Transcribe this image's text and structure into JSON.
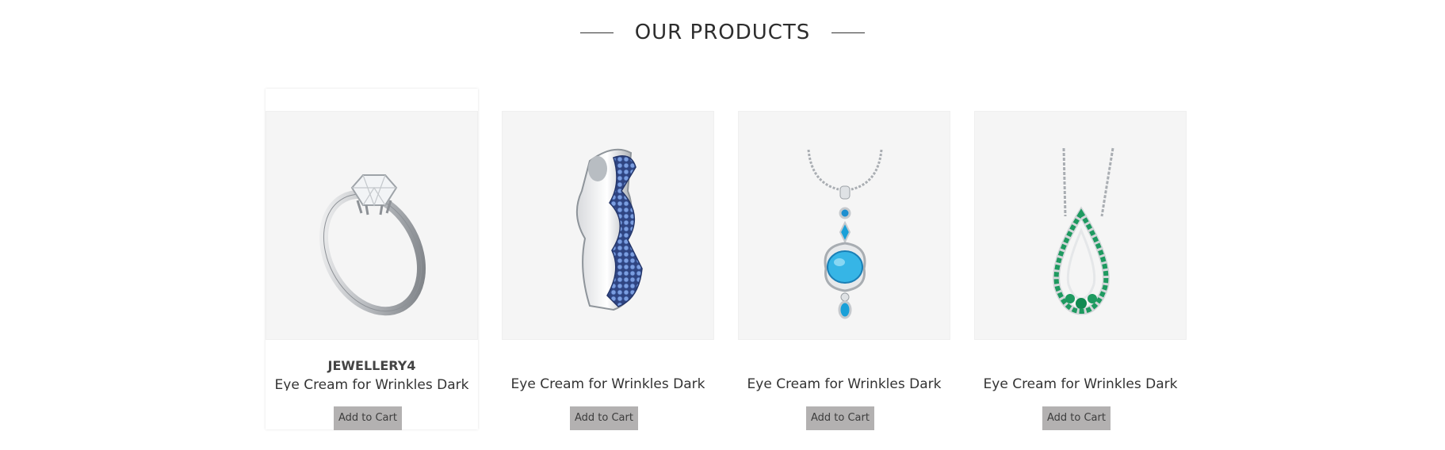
{
  "section": {
    "title": "OUR PRODUCTS"
  },
  "products": [
    {
      "brand": "JEWELLERY4",
      "name": "Eye Cream for Wrinkles Dark",
      "cart_label": "Add to Cart",
      "image": "diamond-ring-icon"
    },
    {
      "name": "Eye Cream for Wrinkles Dark",
      "cart_label": "Add to Cart",
      "image": "sapphire-band-ring-icon"
    },
    {
      "name": "Eye Cream for Wrinkles Dark",
      "cart_label": "Add to Cart",
      "image": "turquoise-pendant-icon"
    },
    {
      "name": "Eye Cream for Wrinkles Dark",
      "cart_label": "Add to Cart",
      "image": "emerald-teardrop-pendant-icon"
    }
  ],
  "colors": {
    "thumb_bg": "#f5f5f5",
    "button_bg": "#b3b1b1",
    "sapphire": "#5f83cf",
    "turquoise": "#1aa0d8",
    "emerald": "#1e9a60"
  }
}
